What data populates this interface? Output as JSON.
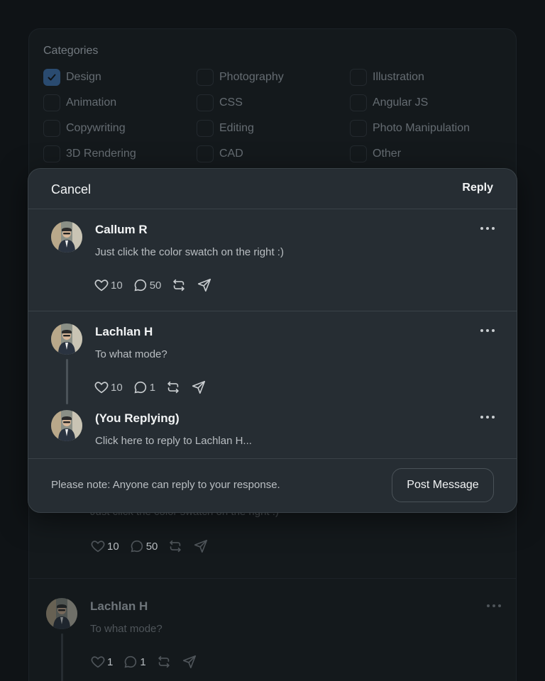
{
  "background": {
    "categories_label": "Categories",
    "categories": [
      {
        "label": "Design",
        "checked": true
      },
      {
        "label": "Photography",
        "checked": false
      },
      {
        "label": "Illustration",
        "checked": false
      },
      {
        "label": "Animation",
        "checked": false
      },
      {
        "label": "CSS",
        "checked": false
      },
      {
        "label": "Angular JS",
        "checked": false
      },
      {
        "label": "Copywriting",
        "checked": false
      },
      {
        "label": "Editing",
        "checked": false
      },
      {
        "label": "Photo Manipulation",
        "checked": false
      },
      {
        "label": "3D Rendering",
        "checked": false
      },
      {
        "label": "CAD",
        "checked": false
      },
      {
        "label": "Other",
        "checked": false
      }
    ],
    "comment1": {
      "text": "Just click the color swatch on the right :)",
      "likes": "10",
      "comments": "50"
    },
    "comment2": {
      "name": "Lachlan H",
      "text": "To what mode?",
      "likes": "1",
      "comments": "1"
    }
  },
  "modal": {
    "cancel_label": "Cancel",
    "reply_label": "Reply",
    "posts": [
      {
        "name": "Callum R",
        "text": "Just click the color swatch on the right :)",
        "likes": "10",
        "comments": "50"
      },
      {
        "name": "Lachlan H",
        "text": "To what mode?",
        "likes": "10",
        "comments": "1"
      }
    ],
    "reply": {
      "name": "(You Replying)",
      "placeholder": "Click here to reply to Lachlan H..."
    },
    "footer_note": "Please note: Anyone can reply to your response.",
    "post_button": "Post Message"
  },
  "colors": {
    "checkbox_checked": "#2a4b70",
    "modal_bg": "#262d33",
    "page_bg": "#0f1316"
  }
}
